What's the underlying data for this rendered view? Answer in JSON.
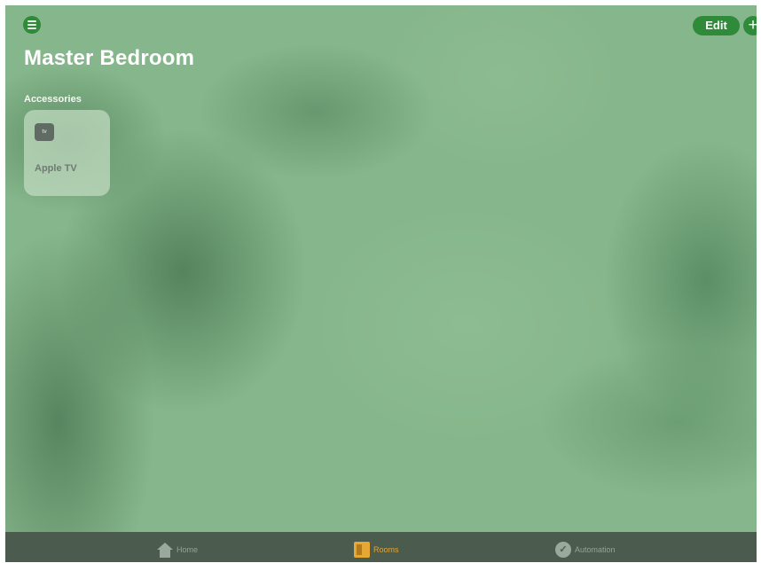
{
  "header": {
    "menu_icon": "list-icon",
    "edit_label": "Edit",
    "add_label": "+"
  },
  "page": {
    "title": "Master Bedroom",
    "section_label": "Accessories"
  },
  "accessories": [
    {
      "name": "Apple TV",
      "icon": "apple-tv-icon",
      "icon_text": "tv"
    }
  ],
  "tabbar": {
    "tabs": [
      {
        "label": "Home",
        "icon": "house-icon",
        "selected": false
      },
      {
        "label": "Rooms",
        "icon": "rooms-icon",
        "selected": true
      },
      {
        "label": "Automation",
        "icon": "automation-icon",
        "selected": false
      }
    ]
  },
  "colors": {
    "accent": "#2f8a3a",
    "selected_tab": "#e0a53a",
    "tab_bar": "#4b5b4e",
    "background": "#86b68b"
  }
}
